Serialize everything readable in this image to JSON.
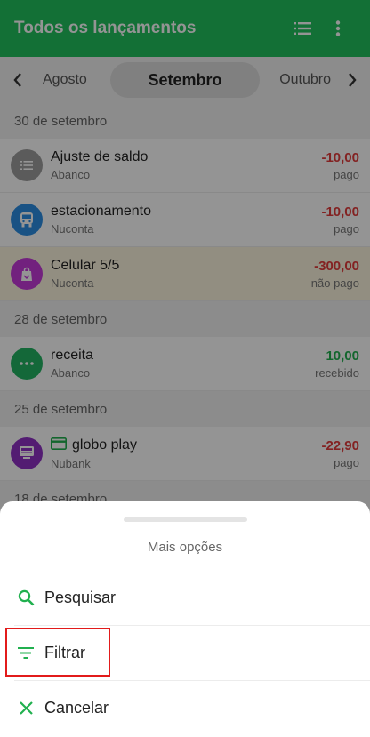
{
  "appbar": {
    "title": "Todos os lançamentos",
    "list_icon": "list-icon",
    "more_icon": "more-vert-icon"
  },
  "months": {
    "prev": "Agosto",
    "current": "Setembro",
    "next": "Outubro"
  },
  "sections": [
    {
      "date": "30 de setembro",
      "items": [
        {
          "name": "Ajuste de saldo",
          "account": "Abanco",
          "amount": "-10,00",
          "status": "pago",
          "icon": "list-icon",
          "color": "#9e9e9e"
        },
        {
          "name": "estacionamento",
          "account": "Nuconta",
          "amount": "-10,00",
          "status": "pago",
          "icon": "bus-icon",
          "color": "#2c8ee3"
        },
        {
          "name": "Celular 5/5",
          "account": "Nuconta",
          "amount": "-300,00",
          "status": "não pago",
          "icon": "shopping-bag-icon",
          "color": "#c43ad9"
        }
      ]
    },
    {
      "date": "28 de setembro",
      "items": [
        {
          "name": "receita",
          "account": "Abanco",
          "amount": "10,00",
          "status": "recebido",
          "icon": "more-horiz-icon",
          "color": "#24b463"
        }
      ]
    },
    {
      "date": "25 de setembro",
      "items": [
        {
          "name": "globo play",
          "account": "Nubank",
          "amount": "-22,90",
          "status": "pago",
          "icon": "tv-icon",
          "color": "#8f31c4",
          "card_icon": "credit-card-icon"
        }
      ]
    },
    {
      "date": "18 de setembro",
      "items": []
    }
  ],
  "sheet": {
    "title": "Mais opções",
    "options": [
      {
        "label": "Pesquisar",
        "icon": "search-icon"
      },
      {
        "label": "Filtrar",
        "icon": "filter-icon"
      },
      {
        "label": "Cancelar",
        "icon": "close-icon"
      }
    ]
  },
  "colors": {
    "primary": "#21c25e",
    "negative": "#e23b3b",
    "positive": "#21b04f",
    "highlight_box": "#e21b1b"
  }
}
